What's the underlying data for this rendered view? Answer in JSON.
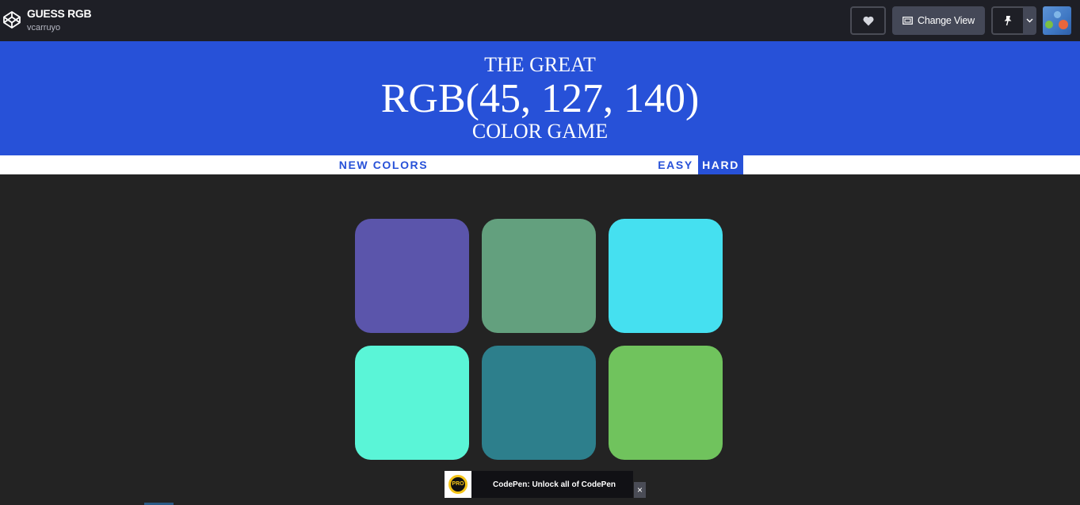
{
  "topbar": {
    "title": "GUESS RGB",
    "author": "vcarruyo",
    "change_view_label": "Change View",
    "icons": {
      "logo": "codepen-logo-icon",
      "heart": "heart-icon",
      "change_view": "layout-icon",
      "pin": "pin-icon",
      "caret": "chevron-down-icon"
    }
  },
  "game": {
    "header": {
      "line1": "THE GREAT",
      "rgb_display": "RGB(45, 127, 140)",
      "line3": "COLOR GAME"
    },
    "controls": {
      "new_colors": "NEW COLORS",
      "easy": "EASY",
      "hard": "HARD",
      "selected_mode": "HARD"
    },
    "colors": {
      "header_bg": "#2751d8",
      "body_bg": "#232323"
    },
    "squares": [
      "#5b55ab",
      "#63a07e",
      "#45e0f0",
      "#5af5d7",
      "#2d7f8c",
      "#70c35d"
    ]
  },
  "promo": {
    "badge": "PRO",
    "text": "CodePen: Unlock all of CodePen",
    "close": "×"
  }
}
